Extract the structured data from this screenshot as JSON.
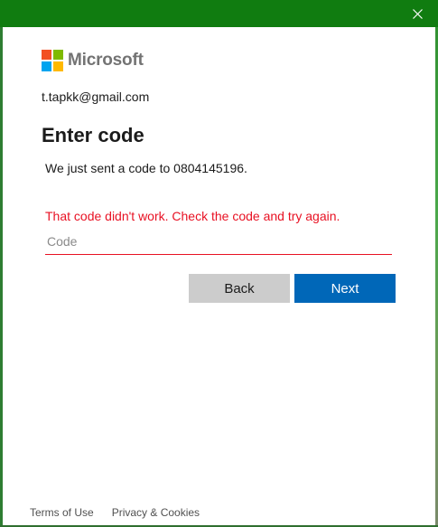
{
  "window": {
    "title_bar_color": "#107c10",
    "close_icon": "close-icon"
  },
  "brand": {
    "name": "Microsoft",
    "logo_icon": "microsoft-logo-icon",
    "colors": [
      "#f25022",
      "#7fba00",
      "#00a4ef",
      "#ffb900"
    ]
  },
  "account": {
    "email": "t.tapkk@gmail.com"
  },
  "main": {
    "heading": "Enter code",
    "description": "We just sent a code to 0804145196.",
    "error_message": "That code didn't work. Check the code and try again.",
    "error_color": "#e81123",
    "code_input": {
      "value": "",
      "placeholder": "Code"
    }
  },
  "buttons": {
    "back_label": "Back",
    "next_label": "Next",
    "accent": "#0067b8"
  },
  "footer": {
    "terms_label": "Terms of Use",
    "privacy_label": "Privacy & Cookies"
  }
}
